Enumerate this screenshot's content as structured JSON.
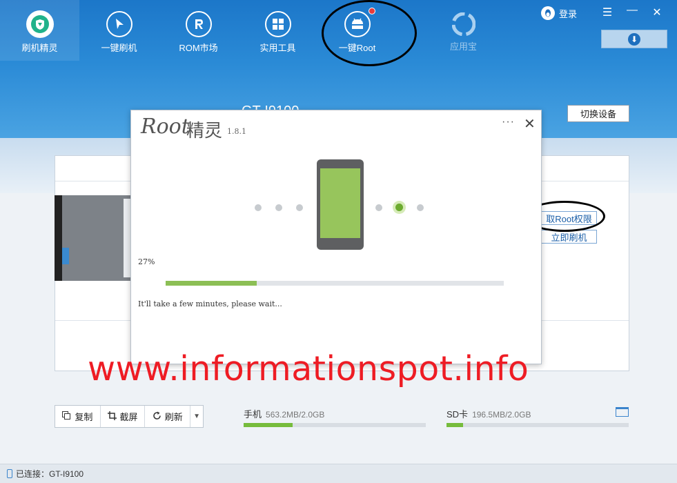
{
  "nav": {
    "items": [
      {
        "label": "刷机精灵",
        "icon": "shield-logo-icon"
      },
      {
        "label": "一键刷机",
        "icon": "cursor-icon"
      },
      {
        "label": "ROM市场",
        "icon": "rom-r-icon"
      },
      {
        "label": "实用工具",
        "icon": "grid-tools-icon"
      },
      {
        "label": "一键Root",
        "icon": "android-root-icon"
      },
      {
        "label": "应用宝",
        "icon": "appstore-icon"
      }
    ]
  },
  "header": {
    "login_label": "登录",
    "device_name": "GT-I9100",
    "switch_device_label": "切换设备"
  },
  "side_actions": {
    "root_label": "取Root权限",
    "flash_label": "立即刷机"
  },
  "dialog": {
    "logo_text": "Root",
    "logo_cn": "精灵",
    "version": "1.8.1",
    "more_label": "···",
    "close_label": "✕",
    "progress_text": "27%",
    "progress_value": 0.27,
    "wait_text": "It'll take a few minutes, please wait..."
  },
  "watermark": "www.informationspot.info",
  "toolbar": {
    "copy_label": "复制",
    "screenshot_label": "截屏",
    "refresh_label": "刷新"
  },
  "storage": {
    "phone_label": "手机",
    "phone_value": "563.2MB/2.0GB",
    "phone_fraction": 0.27,
    "sd_label": "SD卡",
    "sd_value": "196.5MB/2.0GB",
    "sd_fraction": 0.09
  },
  "status": {
    "connected_text": "已连接：GT-I9100"
  },
  "colors": {
    "header_blue": "#1c77c9",
    "progress_green": "#8cbf55",
    "watermark_red": "#ee1c24"
  }
}
